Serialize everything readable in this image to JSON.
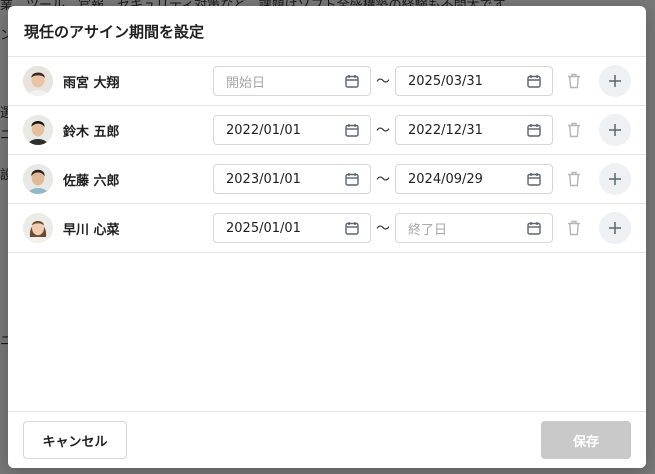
{
  "background": {
    "text_top": "業、ツール、官報、セキュリティ対策など、課題はソフト全盛構築の経験も不問大です。",
    "frag1": "ン",
    "frag2": "選",
    "frag3": "ニ",
    "frag4": "設",
    "frag5": "ニ"
  },
  "modal": {
    "title": "現任のアサイン期間を設定",
    "rows": [
      {
        "name": "雨宮 大翔",
        "start": "",
        "start_placeholder": "開始日",
        "end": "2025/03/31",
        "end_placeholder": "終了日"
      },
      {
        "name": "鈴木 五郎",
        "start": "2022/01/01",
        "start_placeholder": "開始日",
        "end": "2022/12/31",
        "end_placeholder": "終了日"
      },
      {
        "name": "佐藤 六郎",
        "start": "2023/01/01",
        "start_placeholder": "開始日",
        "end": "2024/09/29",
        "end_placeholder": "終了日"
      },
      {
        "name": "早川 心菜",
        "start": "2025/01/01",
        "start_placeholder": "開始日",
        "end": "",
        "end_placeholder": "終了日"
      }
    ],
    "range_separator": "〜",
    "cancel_label": "キャンセル",
    "save_label": "保存"
  },
  "icons": {
    "date": "calendar-icon",
    "delete": "trash-icon",
    "add": "plus-icon"
  },
  "colors": {
    "save_disabled": "#c9c9c9",
    "plus_bg": "#eef0f3",
    "icon": "#5b6470",
    "trash": "#b5b5b5",
    "placeholder": "#a7a7a7"
  }
}
